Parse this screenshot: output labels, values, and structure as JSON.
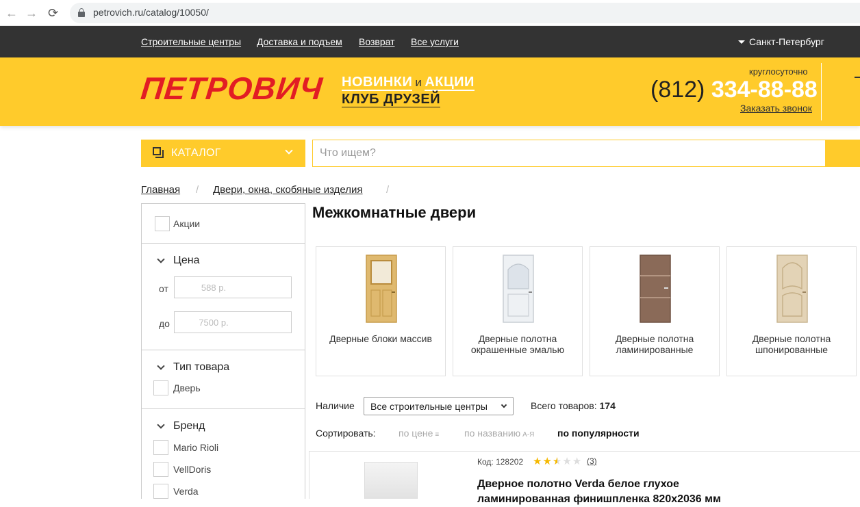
{
  "browser": {
    "url": "petrovich.ru/catalog/10050/"
  },
  "topbar": {
    "links": [
      "Строительные центры",
      "Доставка и подъем",
      "Возврат",
      "Все услуги"
    ],
    "city": "Санкт-Петербург"
  },
  "header": {
    "logo": "ПЕТРОВИЧ",
    "promo_new": "НОВИНКИ",
    "promo_and": "и",
    "promo_sales": "АКЦИИ",
    "promo_club": "КЛУБ ДРУЗЕЙ",
    "hours": "круглосуточно",
    "phone_code": "(812)",
    "phone_number": "334-88-88",
    "callback": "Заказать звонок"
  },
  "catalog": {
    "button_label": "КАТАЛОГ"
  },
  "search": {
    "placeholder": "Что ищем?"
  },
  "breadcrumb": {
    "items": [
      "Главная",
      "Двери, окна, скобяные изделия"
    ],
    "separator": "/"
  },
  "filters": {
    "sale_label": "Акции",
    "price_heading": "Цена",
    "price_from_label": "от",
    "price_from_placeholder": "588 р.",
    "price_to_label": "до",
    "price_to_placeholder": "7500 р.",
    "type_heading": "Тип товара",
    "type_options": [
      "Дверь"
    ],
    "brand_heading": "Бренд",
    "brand_options": [
      "Mario Rioli",
      "VellDoris",
      "Verda"
    ]
  },
  "main": {
    "title": "Межкомнатные двери",
    "categories": [
      {
        "label": "Дверные блоки массив",
        "icon": "solid-wood-door-icon",
        "color": "#dfb96f"
      },
      {
        "label": "Дверные полотна окрашенные эмалью",
        "icon": "white-enamel-door-icon",
        "color": "#eef1f4"
      },
      {
        "label": "Дверные полотна ламинированные",
        "icon": "laminated-door-icon",
        "color": "#8a6a58"
      },
      {
        "label": "Дверные полотна шпонированные",
        "icon": "veneer-door-icon",
        "color": "#e3d3b6"
      }
    ],
    "availability_label": "Наличие",
    "availability_value": "Все строительные центры",
    "total_label": "Всего товаров:",
    "total_count": "174",
    "sort_label": "Сортировать:",
    "sort_options": [
      {
        "label": "по цене",
        "icon": "sort-lines-icon",
        "active": false
      },
      {
        "label": "по названию",
        "hint": "А-Я",
        "active": false
      },
      {
        "label": "по популярности",
        "active": true
      }
    ]
  },
  "product": {
    "code": "Код: 128202",
    "rating": 2.5,
    "rating_max": 5,
    "reviews": "(3)",
    "title": "Дверное полотно Verda белое глухое ламинированная финишпленка 820х2036 мм"
  },
  "colors": {
    "brand_yellow": "#ffcb2b",
    "logo_red": "#e21d24",
    "topbar_dark": "#333333"
  }
}
